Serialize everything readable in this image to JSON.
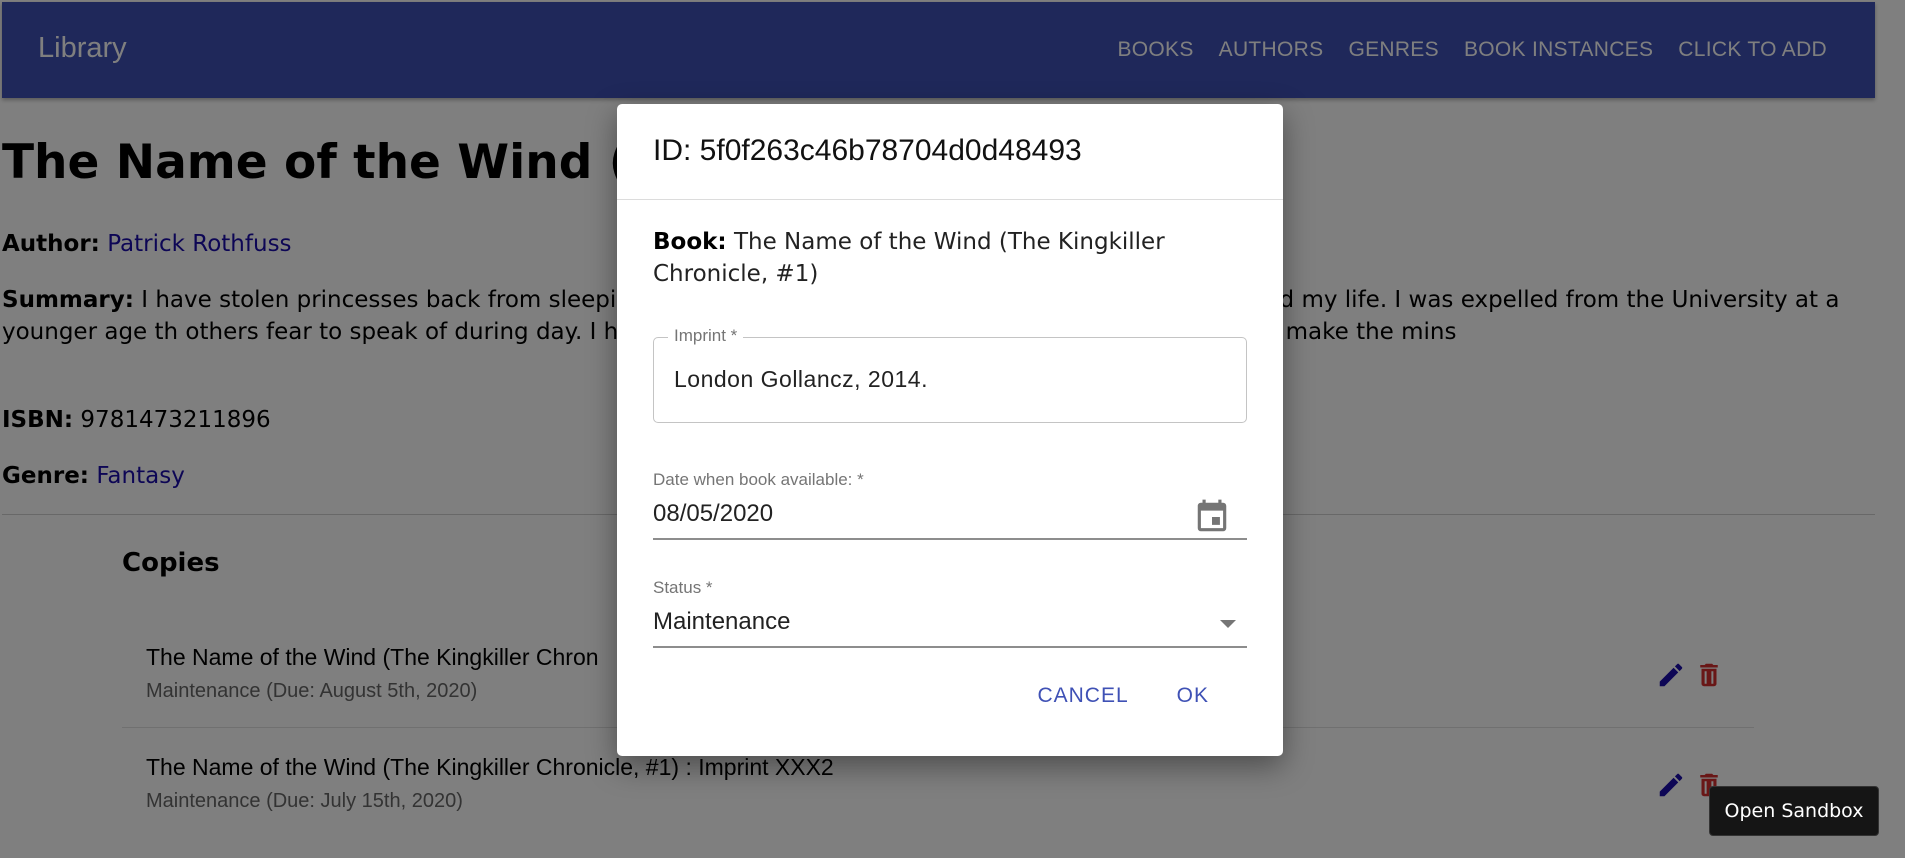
{
  "appbar": {
    "brand": "Library",
    "nav": [
      "BOOKS",
      "AUTHORS",
      "GENRES",
      "BOOK INSTANCES",
      "CLICK TO ADD"
    ]
  },
  "book": {
    "title": "The Name of the Wind (The",
    "author_label": "Author:",
    "author": "Patrick Rothfuss",
    "summary_label": "Summary:",
    "summary": "I have stolen princesses back from sleeping bar                                                                                                          night with Felurian and left with both my sanity and my life. I was expelled from the University at a younger age th                                                                                                     others fear to speak of during day. I have talked to Gods, loved women, and written songs that make the mins",
    "isbn_label": "ISBN:",
    "isbn": "9781473211896",
    "genre_label": "Genre:",
    "genre": "Fantasy"
  },
  "copies": {
    "title": "Copies",
    "rows": [
      {
        "primary": "The Name of the Wind (The Kingkiller Chron",
        "secondary": "Maintenance (Due: August 5th, 2020)"
      },
      {
        "primary": "The Name of the Wind (The Kingkiller Chronicle, #1) : Imprint XXX2",
        "secondary": "Maintenance (Due: July 15th, 2020)"
      }
    ]
  },
  "dialog": {
    "title": "ID: 5f0f263c46b78704d0d48493",
    "book_label": "Book:",
    "book_value": "The Name of the Wind (The Kingkiller Chronicle, #1)",
    "imprint_label": "Imprint *",
    "imprint_value": "London Gollancz, 2014.",
    "date_label": "Date when book available: *",
    "date_value": "08/05/2020",
    "status_label": "Status *",
    "status_value": "Maintenance",
    "cancel": "CANCEL",
    "ok": "OK"
  },
  "sandbox_label": "Open Sandbox",
  "colors": {
    "appbar": "#3f51b5",
    "link": "#1a0dab",
    "edit_icon": "#1a0dab",
    "delete_icon": "#d32f2f"
  },
  "icons": [
    "calendar-icon",
    "edit-icon",
    "delete-icon",
    "dropdown-caret-icon"
  ]
}
